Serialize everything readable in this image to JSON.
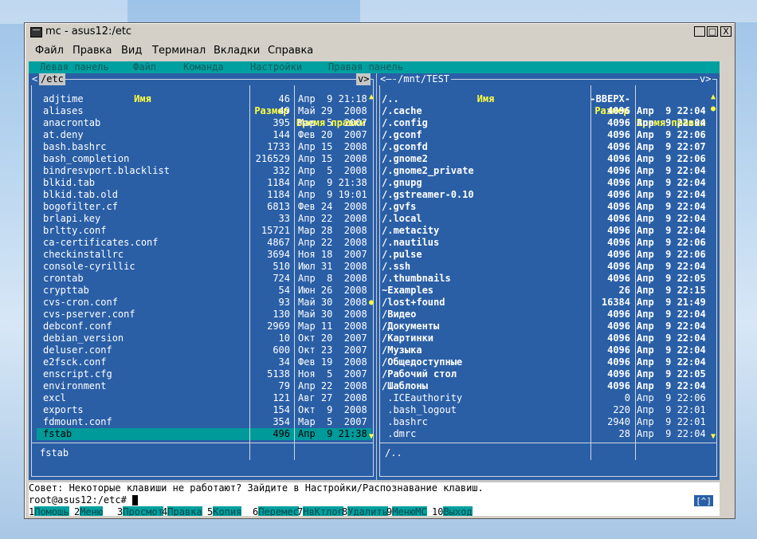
{
  "window": {
    "title": "mc - asus12:/etc",
    "minimize": "_",
    "maximize": "□",
    "close": "X"
  },
  "menubar": [
    "Файл",
    "Правка",
    "Вид",
    "Терминал",
    "Вкладки",
    "Справка"
  ],
  "mcbar": [
    "Левая панель",
    "Файл",
    "Команда",
    "Настройки",
    "Правая панель"
  ],
  "left": {
    "path": "/etc",
    "corner_left": "<",
    "corner_right": "v>",
    "headers": {
      "name": "Имя",
      "size": "Размер",
      "time": "Время правки"
    },
    "files": [
      [
        "adjtime",
        "46",
        "Апр  9 21:18"
      ],
      [
        "aliases",
        "49",
        "Май 29  2008"
      ],
      [
        "anacrontab",
        "395",
        "Мар  5  2007"
      ],
      [
        "at.deny",
        "144",
        "Фев 20  2007"
      ],
      [
        "bash.bashrc",
        "1733",
        "Апр 15  2008"
      ],
      [
        "bash_completion",
        "216529",
        "Апр 15  2008"
      ],
      [
        "bindresvport.blacklist",
        "332",
        "Апр  5  2008"
      ],
      [
        "blkid.tab",
        "1184",
        "Апр  9 21:38"
      ],
      [
        "blkid.tab.old",
        "1184",
        "Апр  9 19:01"
      ],
      [
        "bogofilter.cf",
        "6813",
        "Фев 24  2008"
      ],
      [
        "brlapi.key",
        "33",
        "Апр 22  2008"
      ],
      [
        "brltty.conf",
        "15721",
        "Мар 28  2008"
      ],
      [
        "ca-certificates.conf",
        "4867",
        "Апр 22  2008"
      ],
      [
        "checkinstallrc",
        "3694",
        "Ноя 18  2007"
      ],
      [
        "console-cyrillic",
        "510",
        "Июл 31  2008"
      ],
      [
        "crontab",
        "724",
        "Апр  8  2008"
      ],
      [
        "crypttab",
        "54",
        "Июн 26  2008"
      ],
      [
        "cvs-cron.conf",
        "93",
        "Май 30  2008"
      ],
      [
        "cvs-pserver.conf",
        "130",
        "Май 30  2008"
      ],
      [
        "debconf.conf",
        "2969",
        "Мар 11  2008"
      ],
      [
        "debian_version",
        "10",
        "Окт 20  2007"
      ],
      [
        "deluser.conf",
        "600",
        "Окт 23  2007"
      ],
      [
        "e2fsck.conf",
        "34",
        "Фев 19  2008"
      ],
      [
        "enscript.cfg",
        "5138",
        "Ноя  5  2007"
      ],
      [
        "environment",
        "79",
        "Апр 22  2008"
      ],
      [
        "excl",
        "121",
        "Авг 27  2008"
      ],
      [
        "exports",
        "154",
        "Окт  9  2008"
      ],
      [
        "fdmount.conf",
        "354",
        "Мар  5  2007"
      ],
      [
        "fstab",
        "496",
        "Апр  9 21:38"
      ]
    ],
    "selected": "fstab",
    "footer": "fstab"
  },
  "right": {
    "path": "/mnt/TEST",
    "corner_left": "<—",
    "corner_right": "v>",
    "headers": {
      "name": "Имя",
      "size": "Размер",
      "time": "Время правки"
    },
    "files": [
      [
        "/..",
        "-ВВЕРХ-",
        ""
      ],
      [
        "/.cache",
        "4096",
        "Апр  9 22:04"
      ],
      [
        "/.config",
        "4096",
        "Апр  9 22:04"
      ],
      [
        "/.gconf",
        "4096",
        "Апр  9 22:06"
      ],
      [
        "/.gconfd",
        "4096",
        "Апр  9 22:07"
      ],
      [
        "/.gnome2",
        "4096",
        "Апр  9 22:06"
      ],
      [
        "/.gnome2_private",
        "4096",
        "Апр  9 22:04"
      ],
      [
        "/.gnupg",
        "4096",
        "Апр  9 22:04"
      ],
      [
        "/.gstreamer-0.10",
        "4096",
        "Апр  9 22:04"
      ],
      [
        "/.gvfs",
        "4096",
        "Апр  9 22:04"
      ],
      [
        "/.local",
        "4096",
        "Апр  9 22:04"
      ],
      [
        "/.metacity",
        "4096",
        "Апр  9 22:04"
      ],
      [
        "/.nautilus",
        "4096",
        "Апр  9 22:06"
      ],
      [
        "/.pulse",
        "4096",
        "Апр  9 22:06"
      ],
      [
        "/.ssh",
        "4096",
        "Апр  9 22:04"
      ],
      [
        "/.thumbnails",
        "4096",
        "Апр  9 22:05"
      ],
      [
        "~Examples",
        "26",
        "Апр  9 22:15"
      ],
      [
        "/lost+found",
        "16384",
        "Апр  9 21:49"
      ],
      [
        "/Видео",
        "4096",
        "Апр  9 22:04"
      ],
      [
        "/Документы",
        "4096",
        "Апр  9 22:04"
      ],
      [
        "/Картинки",
        "4096",
        "Апр  9 22:04"
      ],
      [
        "/Музыка",
        "4096",
        "Апр  9 22:04"
      ],
      [
        "/Общедоступные",
        "4096",
        "Апр  9 22:04"
      ],
      [
        "/Рабочий стол",
        "4096",
        "Апр  9 22:05"
      ],
      [
        "/Шаблоны",
        "4096",
        "Апр  9 22:04"
      ],
      [
        " .ICEauthority",
        "0",
        "Апр  9 22:06"
      ],
      [
        " .bash_logout",
        "220",
        "Апр  9 22:01"
      ],
      [
        " .bashrc",
        "2940",
        "Апр  9 22:01"
      ],
      [
        " .dmrc",
        "28",
        "Апр  9 22:04"
      ]
    ],
    "dir_count": 25,
    "footer": "/.."
  },
  "hint": "Совет: Некоторые клавиши не работают? Зайдите в Настройки/Распознавание клавиш.",
  "prompt": "root@asus12:/etc# ",
  "cmd_button": "[^]",
  "fkeys": [
    {
      "num": "1",
      "label": "Помощь"
    },
    {
      "num": "2",
      "label": "Меню"
    },
    {
      "num": "3",
      "label": "Просмот"
    },
    {
      "num": "4",
      "label": "Правка"
    },
    {
      "num": "5",
      "label": "Копия"
    },
    {
      "num": "6",
      "label": "Перемес"
    },
    {
      "num": "7",
      "label": "НвКтлог"
    },
    {
      "num": "8",
      "label": "Удалить"
    },
    {
      "num": "9",
      "label": "МенюМС"
    },
    {
      "num": "10",
      "label": "Выход"
    }
  ]
}
